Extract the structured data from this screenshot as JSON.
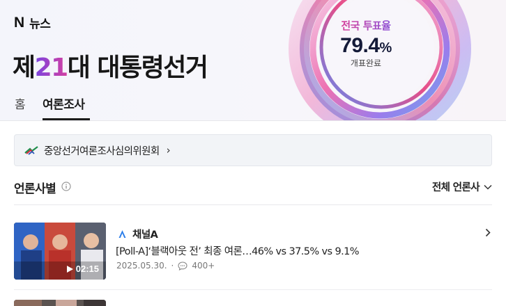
{
  "header": {
    "brand_logo": "N",
    "brand_text": "뉴스",
    "title_prefix": "제",
    "title_number": "21",
    "title_suffix": "대 대통령선거"
  },
  "tabs": [
    {
      "label": "홈",
      "active": false
    },
    {
      "label": "여론조사",
      "active": true
    }
  ],
  "turnout": {
    "label": "전국 투표율",
    "value": "79.4",
    "unit": "%",
    "status": "개표완료"
  },
  "org_link": {
    "label": "중앙선거여론조사심의위원회",
    "chevron": "›",
    "icon": "commission-logo-icon"
  },
  "section": {
    "title": "언론사별",
    "info_icon": "info-icon",
    "filter_label": "전체 언론사",
    "filter_icon": "chevron-down-icon"
  },
  "articles": [
    {
      "press": "채널A",
      "headline": "[Poll-A]‘블랙아웃 전’ 최종 여론…46% vs 37.5% vs 9.1%",
      "date": "2025.05.30.",
      "separator": "·",
      "comments": "400+",
      "duration": "02:15"
    }
  ],
  "colors": {
    "accent_purple": "#7a44e0",
    "accent_pink": "#d43fa0",
    "turnout_navy": "#141a38"
  }
}
